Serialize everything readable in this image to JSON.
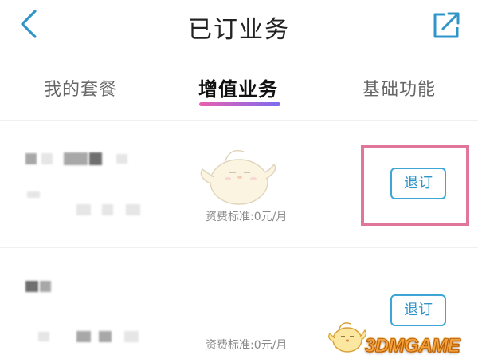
{
  "header": {
    "title": "已订业务",
    "back_icon": "chevron-left-icon",
    "share_icon": "share-external-icon",
    "accent_color": "#2f94c8"
  },
  "tabs": [
    {
      "label": "我的套餐",
      "active": false
    },
    {
      "label": "增值业务",
      "active": true
    },
    {
      "label": "基础功能",
      "active": false
    }
  ],
  "services": [
    {
      "price_text": "资费标准:0元/月",
      "action_label": "退订",
      "highlighted": true
    },
    {
      "price_text": "资费标准:0元/月",
      "action_label": "退订",
      "highlighted": false
    }
  ],
  "watermark": {
    "text": "3DMGAME"
  },
  "colors": {
    "tab_underline_start": "#e95fae",
    "tab_underline_end": "#7c6cf0",
    "highlight_border": "#e0779a",
    "button_border": "#3da6d6"
  }
}
